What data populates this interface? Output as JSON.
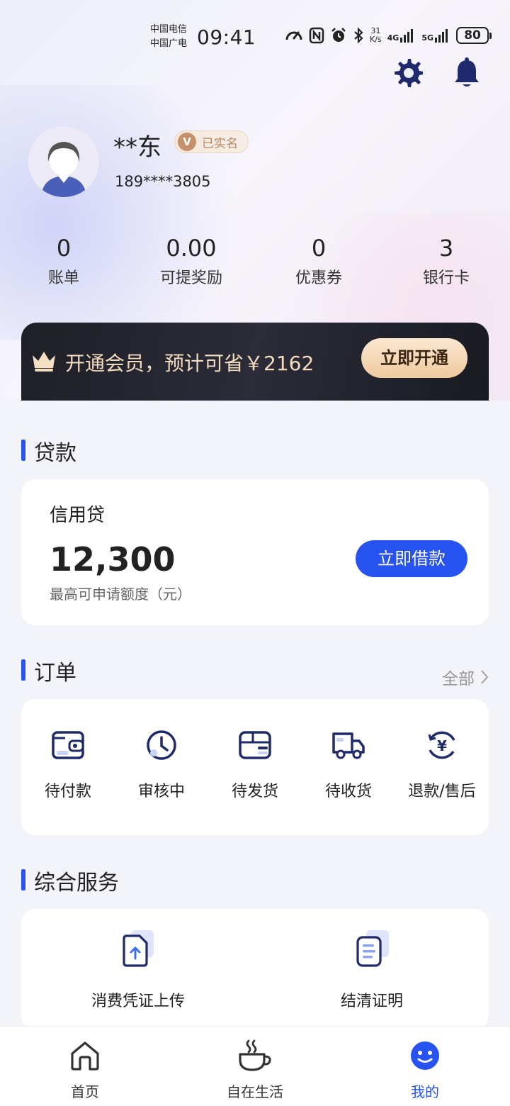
{
  "status_bar": {
    "carrier_1": "中国电信",
    "carrier_2": "中国广电",
    "time": "09:41",
    "speed_value": "31",
    "speed_unit": "K/s",
    "net_1": "4G",
    "net_2": "5G",
    "battery": "80"
  },
  "header": {
    "icons": [
      "gear-icon",
      "bell-icon"
    ]
  },
  "user": {
    "name": "**东",
    "verified_badge_letter": "V",
    "verified_label": "已实名",
    "phone": "189****3805"
  },
  "stats": [
    {
      "value": "0",
      "label": "账单"
    },
    {
      "value": "0.00",
      "label": "可提奖励"
    },
    {
      "value": "0",
      "label": "优惠券"
    },
    {
      "value": "3",
      "label": "银行卡"
    }
  ],
  "member": {
    "text": "开通会员，预计可省￥2162",
    "button": "立即开通"
  },
  "loan": {
    "section_title": "贷款",
    "product_name": "信用贷",
    "amount": "12,300",
    "amount_caption": "最高可申请额度（元）",
    "button": "立即借款"
  },
  "orders": {
    "section_title": "订单",
    "more_label": "全部",
    "items": [
      {
        "label": "待付款",
        "icon": "wallet-icon"
      },
      {
        "label": "审核中",
        "icon": "clock-icon"
      },
      {
        "label": "待发货",
        "icon": "package-icon"
      },
      {
        "label": "待收货",
        "icon": "truck-icon"
      },
      {
        "label": "退款/售后",
        "icon": "refund-icon"
      }
    ]
  },
  "services": {
    "section_title": "综合服务",
    "items": [
      {
        "label": "消费凭证上传",
        "icon": "upload-doc-icon"
      },
      {
        "label": "结清证明",
        "icon": "certificate-icon"
      }
    ]
  },
  "tabbar": {
    "items": [
      {
        "label": "首页",
        "icon": "home-icon"
      },
      {
        "label": "自在生活",
        "icon": "coffee-cup-icon"
      },
      {
        "label": "我的",
        "icon": "smiley-icon"
      }
    ],
    "active_index": 2,
    "active_color": "#2753f0"
  }
}
